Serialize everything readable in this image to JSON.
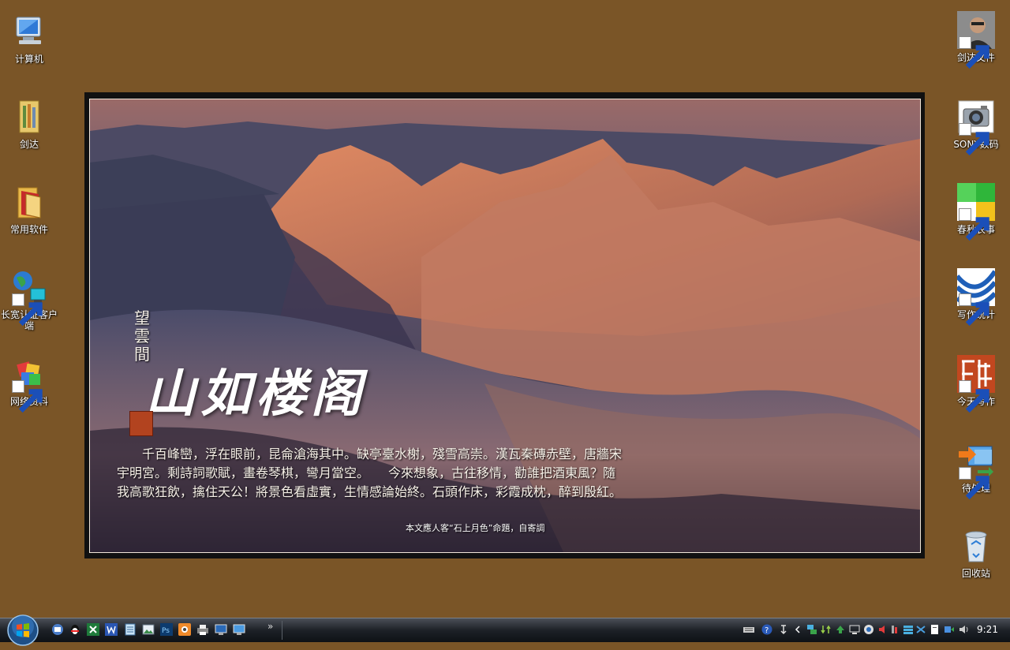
{
  "desktop": {
    "left_icons": [
      {
        "label": "计算机",
        "icon": "computer-icon"
      },
      {
        "label": "剑达",
        "icon": "folder-icon"
      },
      {
        "label": "常用软件",
        "icon": "folder-icon"
      },
      {
        "label": "长宽认证客户端",
        "icon": "network-client-icon"
      },
      {
        "label": "网络资料",
        "icon": "network-data-icon"
      }
    ],
    "right_icons": [
      {
        "label": "剑达文件",
        "icon": "user-photo-icon"
      },
      {
        "label": "SONY数码",
        "icon": "camera-icon"
      },
      {
        "label": "春秋农事",
        "icon": "grid-app-icon"
      },
      {
        "label": "写作统计",
        "icon": "statistics-icon"
      },
      {
        "label": "今天写作",
        "icon": "seal-app-icon"
      },
      {
        "label": "待处理",
        "icon": "pending-transfer-icon"
      },
      {
        "label": "回收站",
        "icon": "recycle-bin-icon"
      }
    ]
  },
  "wallpaper": {
    "small_title": "望雲間",
    "big_title": "山如楼阁",
    "poem": "千百峰巒，浮在眼前，昆侖滄海其中。缺亭臺水榭，殘雪高崇。漢瓦秦磚赤壁，唐牆宋宇明宮。剩詩詞歌賦，畫卷琴棋，彎月當空。　　今來想象，古往移情，勸誰把酒東風？隨我高歌狂飲，擒住天公！將景色看虛實，生情感論始終。石頭作床，彩霞成枕，醉到殷紅。",
    "note": "本文應人客“石上月色”命題，自寄調"
  },
  "taskbar": {
    "start_icon": "windows-start-orb",
    "quick_launch": [
      "desktop-switch-icon",
      "qq-icon",
      "excel-icon",
      "word-icon",
      "notepad-icon",
      "picture-viewer-icon",
      "photoshop-icon",
      "camera-app-icon",
      "printer-icon",
      "network-icon",
      "display-icon"
    ],
    "overflow": "»",
    "tray_icons": [
      "keyboard-icon",
      "help-icon",
      "pin-icon",
      "expand-icon",
      "network-tray-icon",
      "sync-icon",
      "upload-icon",
      "monitor-icon",
      "security-icon",
      "app-red-icon",
      "volume-icon",
      "network-adapter-icon",
      "bluetooth-icon",
      "task-icon",
      "safely-remove-icon",
      "speaker-icon"
    ],
    "clock": "9:21"
  },
  "colors": {
    "desktop_bg": "#7a5527",
    "seal_red": "#b2431f"
  }
}
